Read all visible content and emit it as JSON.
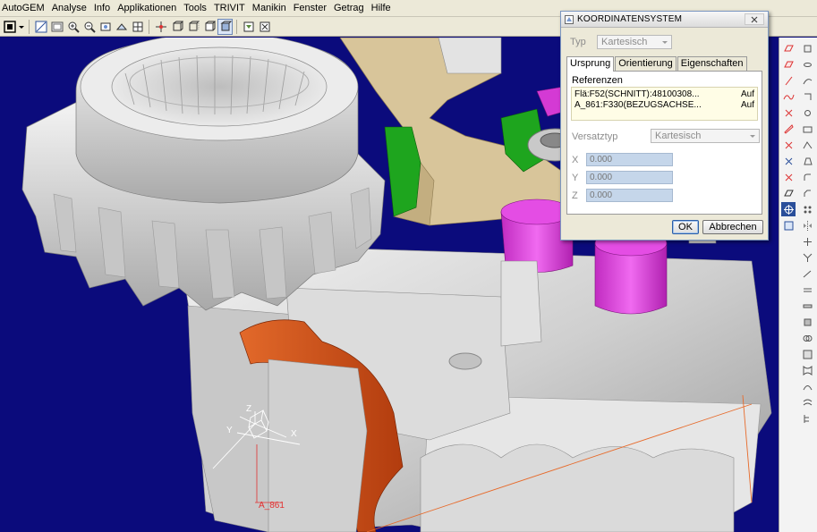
{
  "menu": [
    "AutoGEM",
    "Analyse",
    "Info",
    "Applikationen",
    "Tools",
    "TRIVIT",
    "Manikin",
    "Fenster",
    "Getrag",
    "Hilfe"
  ],
  "toolbar": {
    "icons": [
      "select-icon",
      "dropdown-icon",
      "save-icon",
      "redraw-icon",
      "zoom-in-icon",
      "zoom-out-icon",
      "fit-icon",
      "reorient-icon",
      "views-icon",
      "spin-center-icon",
      "wireframe-icon",
      "hidden-line-icon",
      "no-hidden-icon",
      "shaded-icon",
      "datum-planes-icon",
      "close-window-icon"
    ]
  },
  "dialog": {
    "title": "KOORDINATENSYSTEM",
    "typ_label": "Typ",
    "typ_value": "Kartesisch",
    "tabs": [
      "Ursprung",
      "Orientierung",
      "Eigenschaften"
    ],
    "active_tab": "Ursprung",
    "references_label": "Referenzen",
    "references": [
      {
        "text": "Flä:F52(SCHNITT):48100308...",
        "state": "Auf"
      },
      {
        "text": "A_861:F330(BEZUGSACHSE...",
        "state": "Auf"
      }
    ],
    "versatztyp_label": "Versatztyp",
    "versatztyp_value": "Kartesisch",
    "coords": [
      {
        "label": "X",
        "value": "0.000"
      },
      {
        "label": "Y",
        "value": "0.000"
      },
      {
        "label": "Z",
        "value": "0.000"
      }
    ],
    "ok_label": "OK",
    "cancel_label": "Abbrechen"
  },
  "viewport": {
    "axes": {
      "x": "X",
      "y": "Y",
      "z": "Z"
    },
    "csys_label": "A_861"
  },
  "colors": {
    "background": "#0b0b7c",
    "part": "#d9d9d9",
    "highlight_orange": "#d2541a",
    "tan_part": "#d8c59a",
    "magenta": "#d43ad4",
    "green": "#1ea51e"
  }
}
